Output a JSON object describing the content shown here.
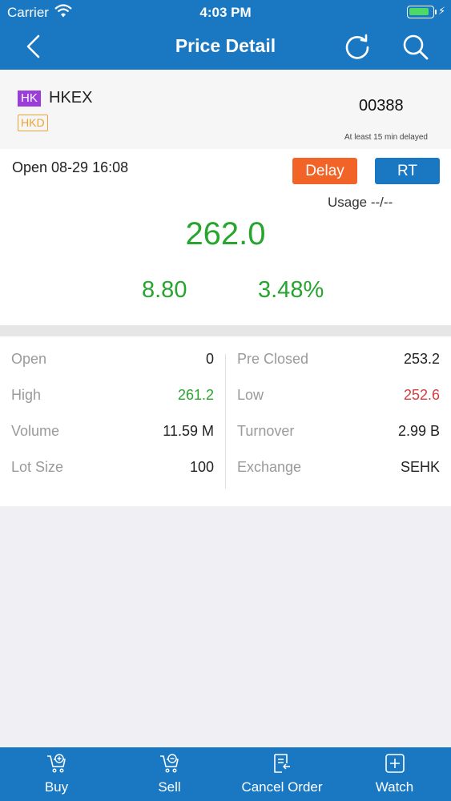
{
  "status_bar": {
    "carrier": "Carrier",
    "time": "4:03 PM",
    "battery_level": 0.9
  },
  "nav": {
    "title": "Price Detail"
  },
  "stock": {
    "market": "HK",
    "name": "HKEX",
    "currency": "HKD",
    "code": "00388",
    "delay_note": "At least 15 min delayed"
  },
  "quote": {
    "open_time": "Open 08-29 16:08",
    "delay_label": "Delay",
    "rt_label": "RT",
    "usage": "Usage --/--",
    "last_price": "262.0",
    "change": "8.80",
    "change_pct": "3.48%"
  },
  "stats": [
    {
      "left_label": "Open",
      "left_value": "0",
      "right_label": "Pre Closed",
      "right_value": "253.2"
    },
    {
      "left_label": "High",
      "left_value": "261.2",
      "right_label": "Low",
      "right_value": "252.6"
    },
    {
      "left_label": "Volume",
      "left_value": "11.59 M",
      "right_label": "Turnover",
      "right_value": "2.99 B"
    },
    {
      "left_label": "Lot Size",
      "left_value": "100",
      "right_label": "Exchange",
      "right_value": "SEHK"
    }
  ],
  "tabbar": {
    "buy": "Buy",
    "sell": "Sell",
    "cancel_order": "Cancel Order",
    "watch": "Watch"
  },
  "colors": {
    "primary": "#1a78c2",
    "up": "#27a52f",
    "down": "#d63c3c",
    "delay": "#f26327",
    "market_tag": "#9b3dd9",
    "currency_tag": "#f0a230"
  },
  "icons": {
    "back": "chevron-left-icon",
    "refresh": "refresh-icon",
    "search": "search-icon",
    "buy": "cart-plus-icon",
    "sell": "cart-minus-icon",
    "cancel_order": "document-return-icon",
    "watch": "plus-square-icon"
  }
}
